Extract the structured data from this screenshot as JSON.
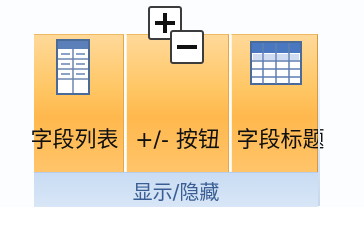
{
  "ribbon_group": {
    "label": "显示/隐藏",
    "buttons": [
      {
        "label": "字段列表",
        "icon": "field-list-icon"
      },
      {
        "label": "+/- 按钮",
        "icon": "plus-minus-buttons-icon"
      },
      {
        "label": "字段标题",
        "icon": "field-headers-icon"
      }
    ]
  },
  "colors": {
    "button_active_bg": "#ffc766",
    "group_label_bg": "#d2e2f6",
    "group_label_text": "#3a5e93"
  }
}
